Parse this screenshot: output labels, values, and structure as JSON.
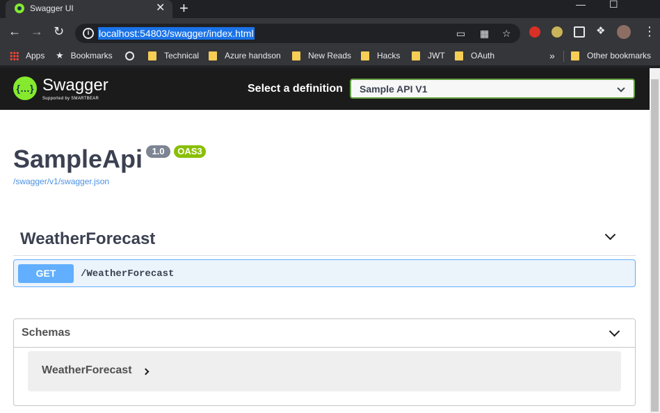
{
  "browser": {
    "tab_title": "Swagger UI",
    "tab_close": "✕",
    "new_tab": "+",
    "url": "localhost:54803/swagger/index.html",
    "window_controls": [
      "—",
      "☐"
    ]
  },
  "bookmarks": {
    "apps": "Apps",
    "bookmarks": "Bookmarks",
    "items": [
      "Technical",
      "Azure handson",
      "New Reads",
      "Hacks",
      "JWT",
      "OAuth"
    ],
    "overflow": "»",
    "other": "Other bookmarks"
  },
  "swagger": {
    "logo_mark": "{…}",
    "logo_text": "Swagger",
    "logo_sub": "Supported by SMARTBEAR",
    "definition_label": "Select a definition",
    "definition_value": "Sample API V1",
    "api_title": "SampleApi",
    "version_badge": "1.0",
    "oas_badge": "OAS3",
    "json_link": "/swagger/v1/swagger.json",
    "tag_name": "WeatherForecast",
    "operation": {
      "method": "GET",
      "path": "/WeatherForecast"
    },
    "schemas_title": "Schemas",
    "schema_items": [
      "WeatherForecast"
    ]
  },
  "colors": {
    "swagger_green": "#85ea2d",
    "get_blue": "#61affe",
    "oas_green": "#89bf04",
    "link_blue": "#4990e2"
  },
  "icons": [
    "back-arrow-icon",
    "forward-arrow-icon",
    "reload-icon",
    "info-icon",
    "star-icon",
    "extensions-icon",
    "kebab-menu-icon",
    "chevron-down-icon",
    "chevron-right-icon"
  ]
}
